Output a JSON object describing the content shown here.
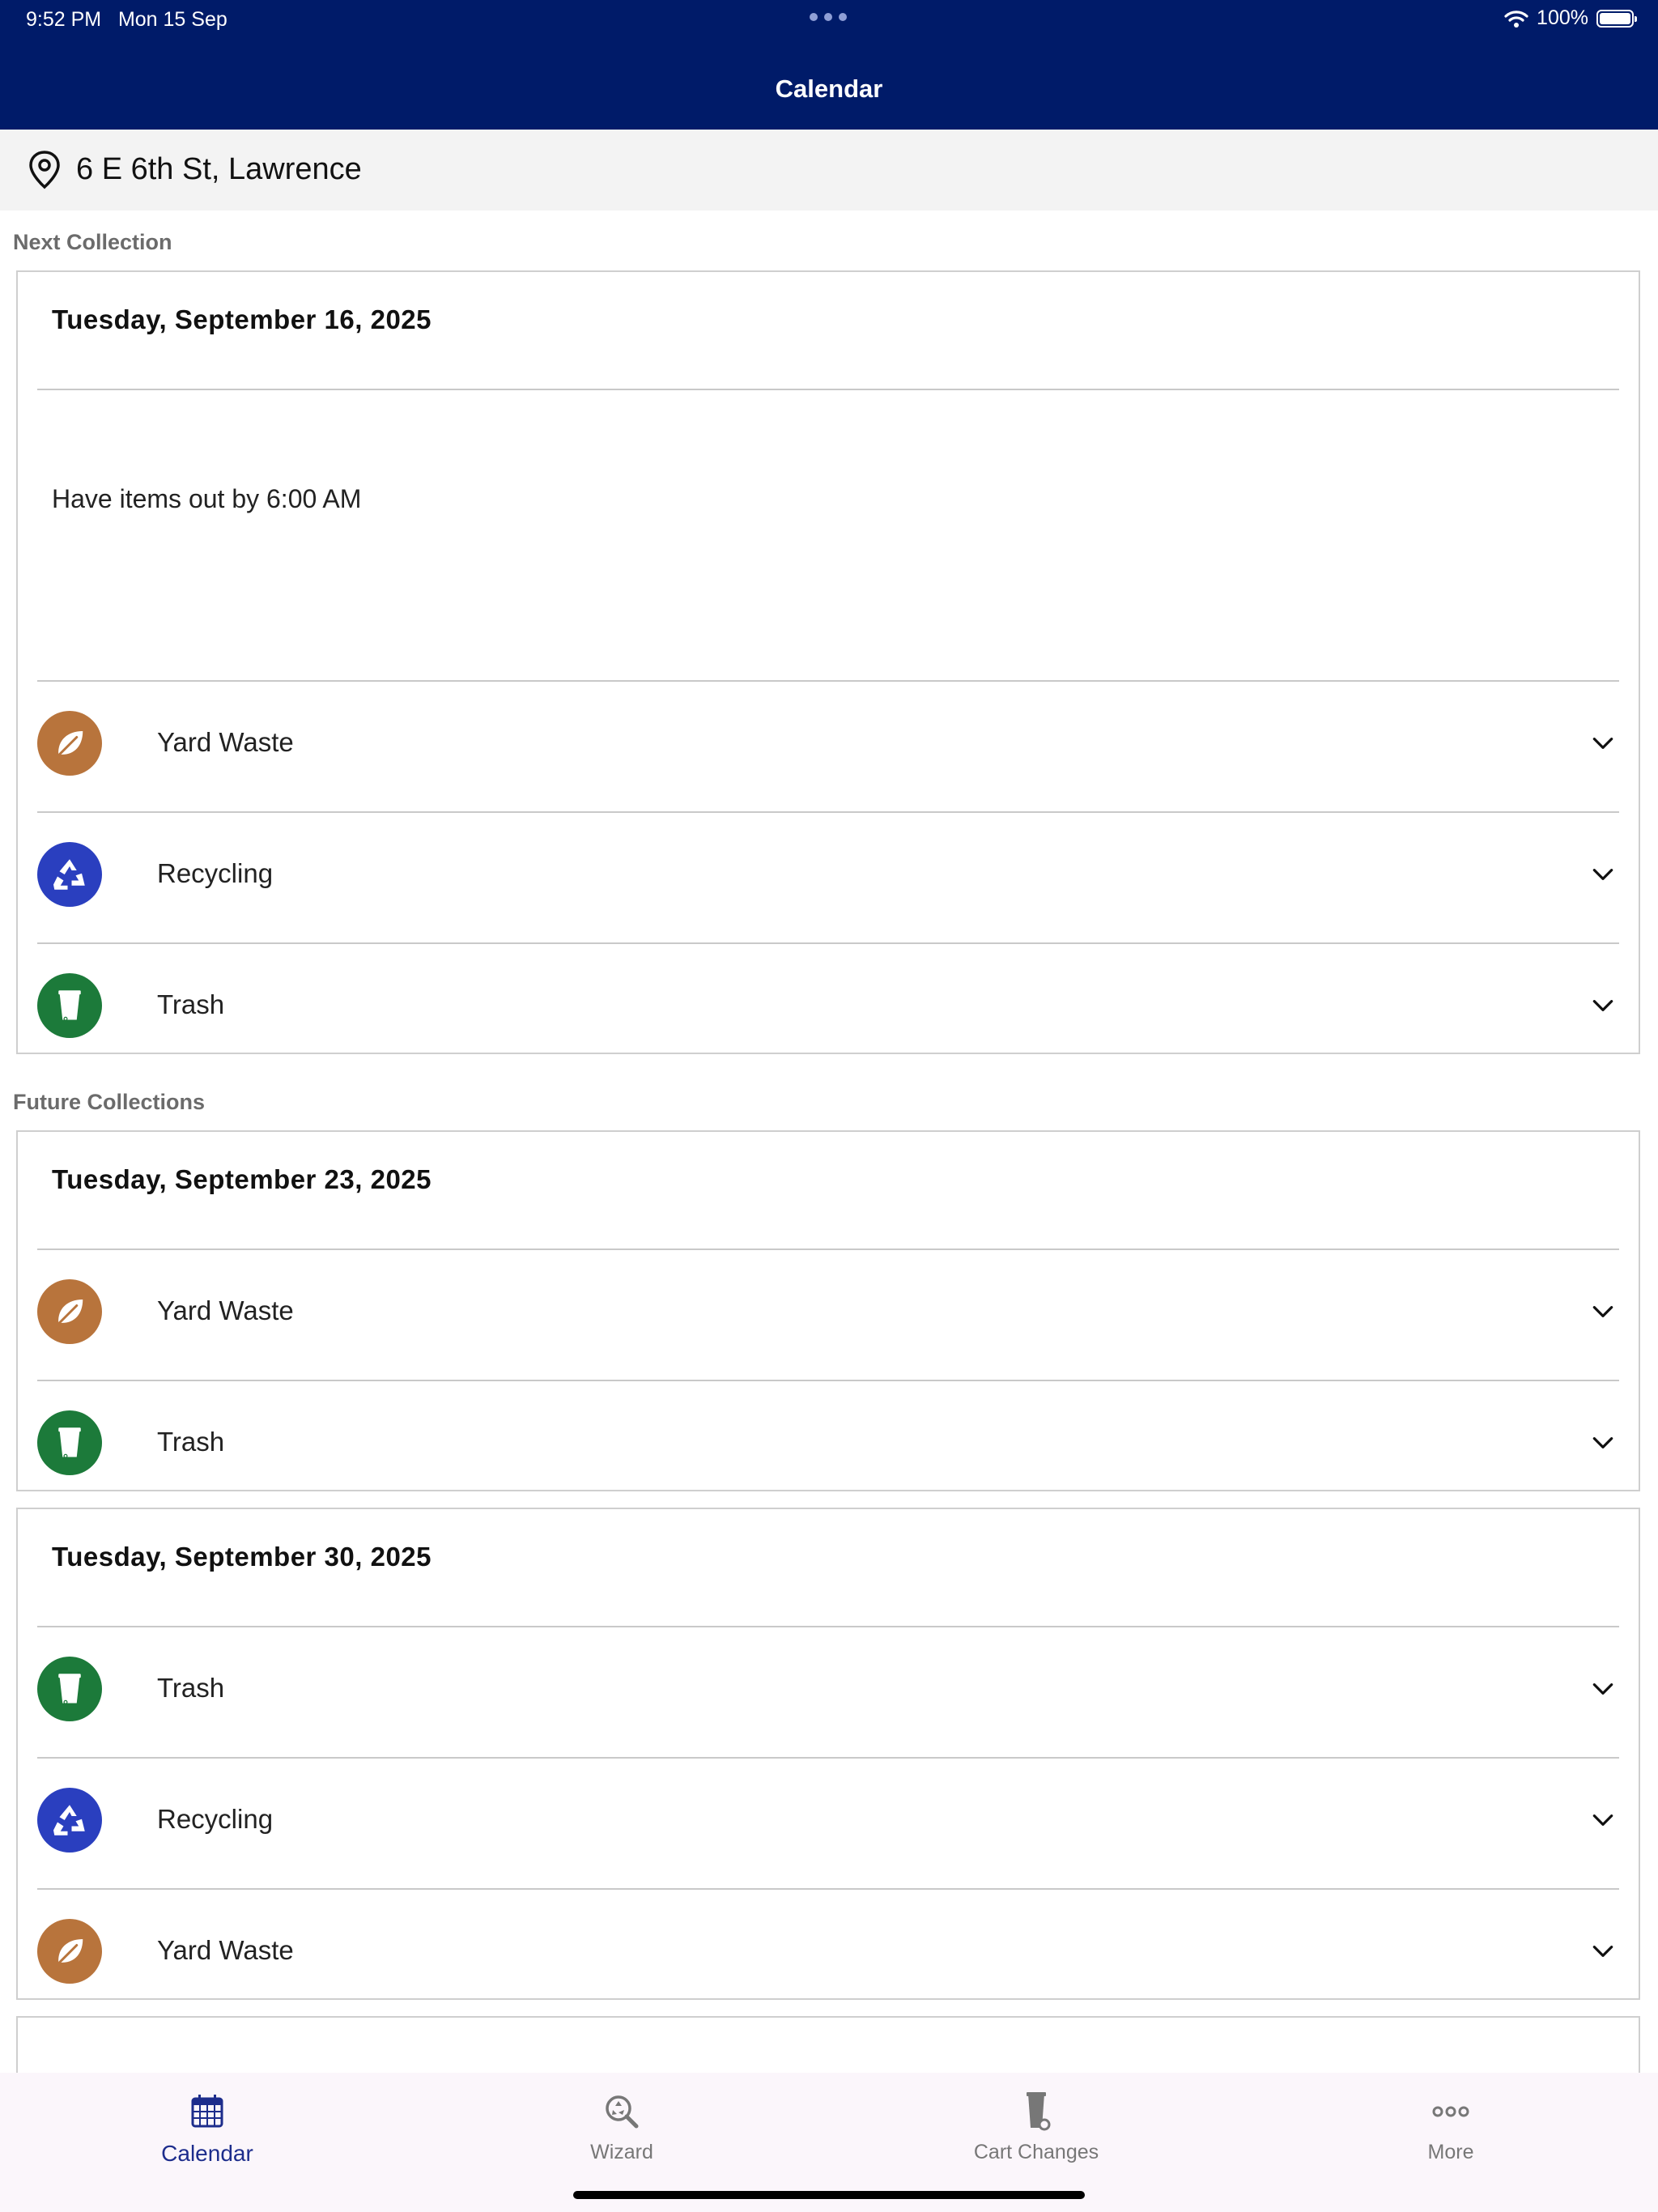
{
  "status_bar": {
    "time": "9:52 PM",
    "date": "Mon 15 Sep",
    "battery": "100%"
  },
  "header": {
    "title": "Calendar"
  },
  "address": {
    "text": "6 E 6th St, Lawrence",
    "icon": "location-pin-icon"
  },
  "next_collection": {
    "label": "Next Collection",
    "date": "Tuesday, September 16, 2025",
    "note": "Have items out by 6:00 AM",
    "items": [
      {
        "label": "Yard Waste",
        "icon": "leaf-icon",
        "color": "#b8743c"
      },
      {
        "label": "Recycling",
        "icon": "recycle-icon",
        "color": "#2a3fbf"
      },
      {
        "label": "Trash",
        "icon": "trash-bin-icon",
        "color": "#1c7a3a"
      }
    ]
  },
  "future_collections": {
    "label": "Future Collections",
    "cards": [
      {
        "date": "Tuesday, September 23, 2025",
        "items": [
          {
            "label": "Yard Waste",
            "icon": "leaf-icon"
          },
          {
            "label": "Trash",
            "icon": "trash-bin-icon"
          }
        ]
      },
      {
        "date": "Tuesday, September 30, 2025",
        "items": [
          {
            "label": "Trash",
            "icon": "trash-bin-icon"
          },
          {
            "label": "Recycling",
            "icon": "recycle-icon"
          },
          {
            "label": "Yard Waste",
            "icon": "leaf-icon"
          }
        ]
      }
    ]
  },
  "tab_bar": {
    "tabs": [
      {
        "label": "Calendar",
        "icon": "calendar-icon",
        "active": true
      },
      {
        "label": "Wizard",
        "icon": "search-recycle-icon",
        "active": false
      },
      {
        "label": "Cart Changes",
        "icon": "cart-icon",
        "active": false
      },
      {
        "label": "More",
        "icon": "more-icon",
        "active": false
      }
    ]
  },
  "colors": {
    "header": "#001b69",
    "active_tab": "#1d2d8c",
    "yard_waste": "#b8743c",
    "recycling": "#2a3fbf",
    "trash": "#1c7a3a"
  }
}
